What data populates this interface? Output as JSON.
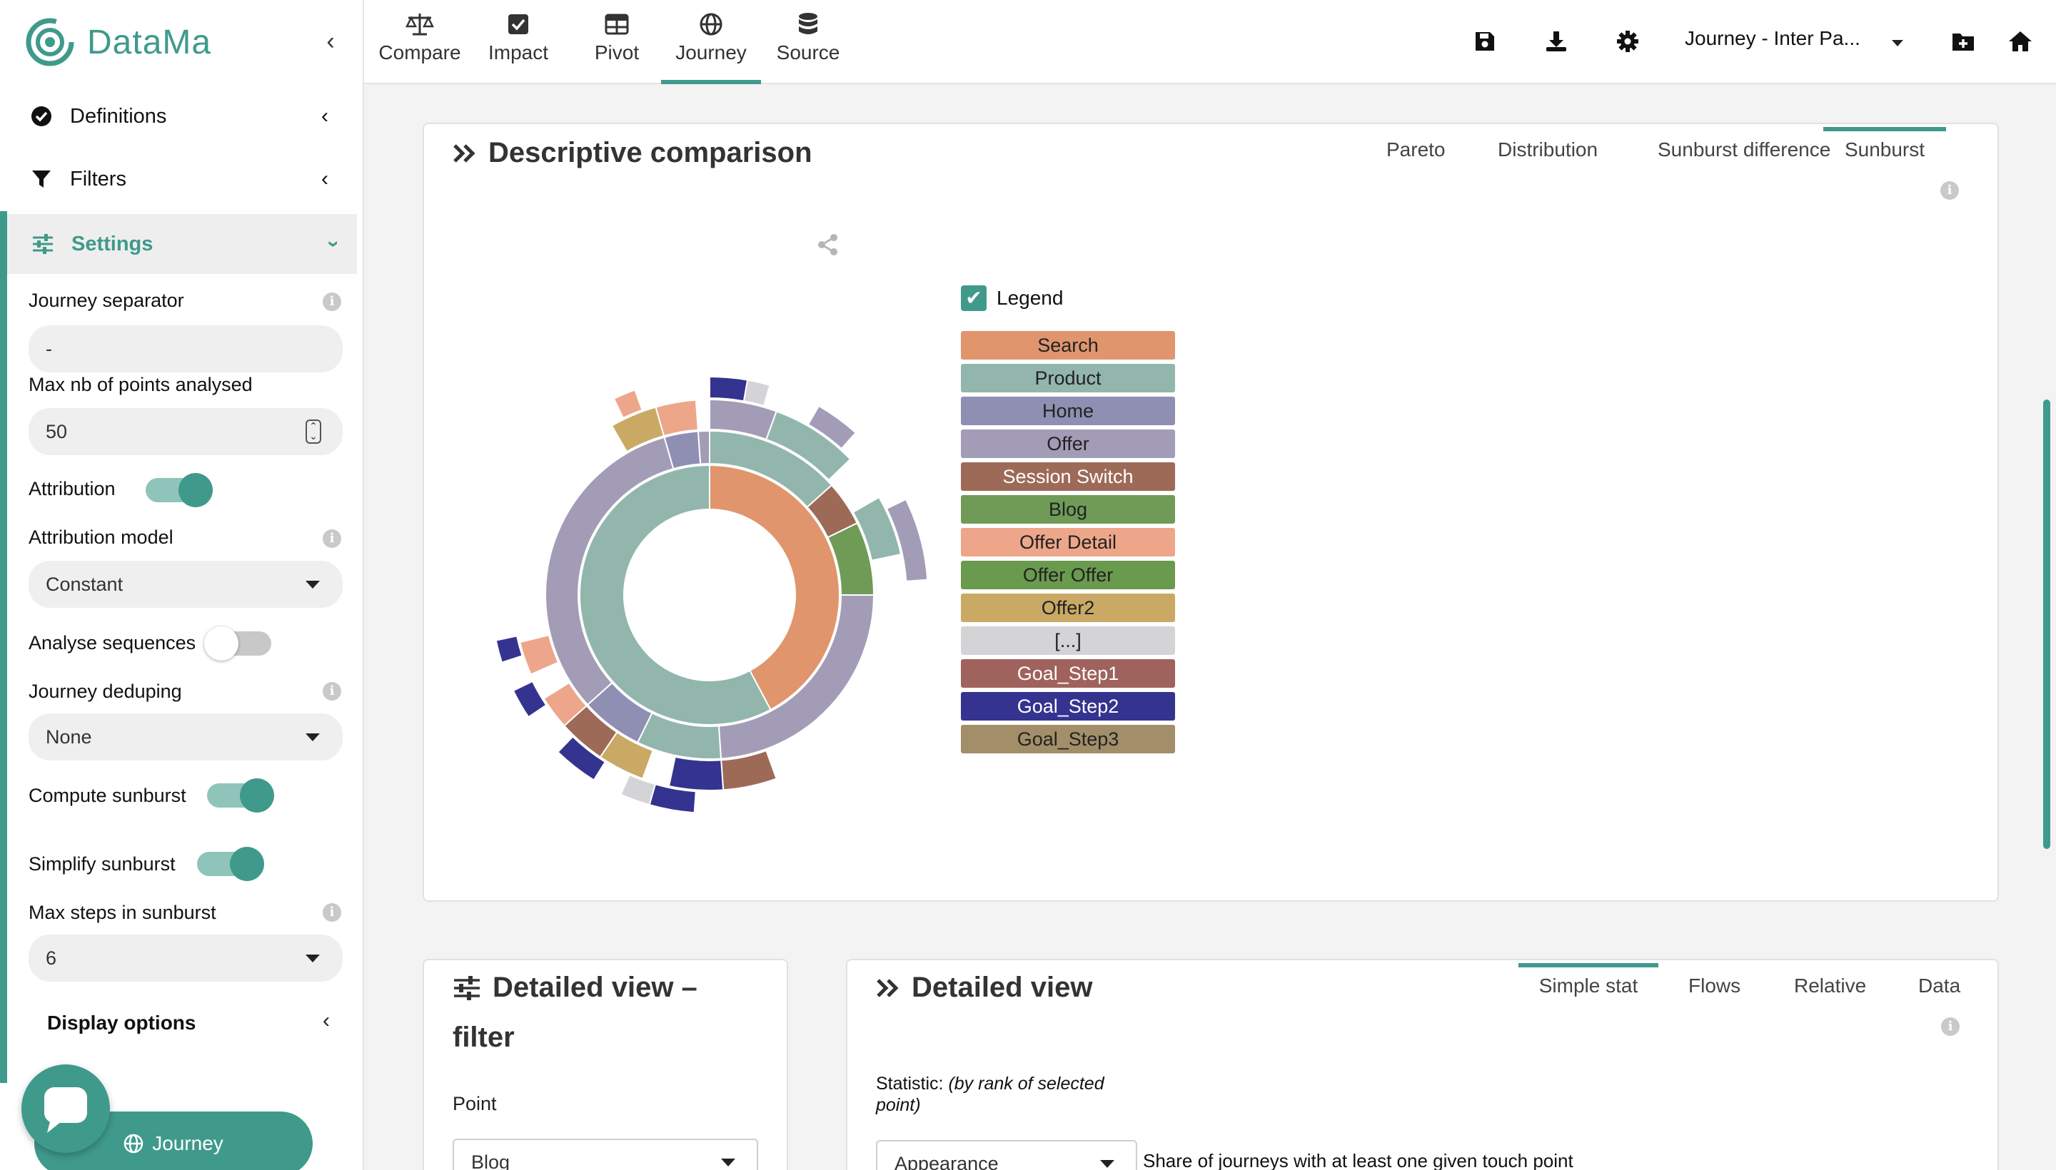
{
  "app": {
    "name": "DataMa",
    "brand_color": "#3f9a8c"
  },
  "topnav": {
    "tabs": [
      {
        "label": "Compare",
        "icon": "balance-scale-icon"
      },
      {
        "label": "Impact",
        "icon": "checkbox-icon"
      },
      {
        "label": "Pivot",
        "icon": "table-icon"
      },
      {
        "label": "Journey",
        "icon": "globe-icon",
        "active": true
      },
      {
        "label": "Source",
        "icon": "database-icon"
      }
    ],
    "journey_select": "Journey - Inter Pa...",
    "actions": [
      "save-icon",
      "download-icon",
      "gear-icon",
      "folder-plus-icon",
      "home-icon"
    ]
  },
  "sidebar": {
    "definitions": "Definitions",
    "filters": "Filters",
    "settings": "Settings",
    "journey_separator": {
      "label": "Journey separator",
      "value": "-"
    },
    "max_points": {
      "label": "Max nb of points analysed",
      "value": "50"
    },
    "attribution": {
      "label": "Attribution",
      "on": true
    },
    "attribution_model": {
      "label": "Attribution model",
      "value": "Constant"
    },
    "analyse_sequences": {
      "label": "Analyse sequences",
      "on": false
    },
    "journey_deduping": {
      "label": "Journey deduping",
      "value": "None"
    },
    "compute_sunburst": {
      "label": "Compute sunburst",
      "on": true
    },
    "simplify_sunburst": {
      "label": "Simplify sunburst",
      "on": true
    },
    "max_steps": {
      "label": "Max steps in sunburst",
      "value": "6"
    },
    "display_options": "Display options",
    "journey_button": "Journey"
  },
  "descriptive": {
    "title": "Descriptive comparison",
    "tabs": [
      "Pareto",
      "Distribution",
      "Sunburst difference",
      "Sunburst"
    ],
    "active_tab": "Sunburst",
    "legend_label": "Legend",
    "legend": [
      {
        "label": "Search",
        "color": "#e0956d"
      },
      {
        "label": "Product",
        "color": "#92b6ac"
      },
      {
        "label": "Home",
        "color": "#8f8fb3"
      },
      {
        "label": "Offer",
        "color": "#a39cb6"
      },
      {
        "label": "Session Switch",
        "color": "#9e6a58"
      },
      {
        "label": "Blog",
        "color": "#6f9b56"
      },
      {
        "label": "Offer Detail",
        "color": "#eda68a"
      },
      {
        "label": "Offer Offer",
        "color": "#6a9a4e"
      },
      {
        "label": "Offer2",
        "color": "#c9a964"
      },
      {
        "label": "[...]",
        "color": "#d4d4d6"
      },
      {
        "label": "Goal_Step1",
        "color": "#a0625d"
      },
      {
        "label": "Goal_Step2",
        "color": "#34338f"
      },
      {
        "label": "Goal_Step3",
        "color": "#a38e6a"
      }
    ]
  },
  "filter_card": {
    "title_line1": "Detailed view –",
    "title_line2": "filter",
    "point_label": "Point",
    "point_value": "Blog"
  },
  "detail_card": {
    "title": "Detailed view",
    "tabs": [
      "Simple stat",
      "Flows",
      "Relative",
      "Data"
    ],
    "active_tab": "Simple stat",
    "statistic_label": "Statistic:",
    "statistic_hint_line1": "(by rank of selected",
    "statistic_hint_line2": "point)",
    "statistic_value": "Appearance",
    "statistic_description": "Share of journeys with at least one given touch point"
  }
}
